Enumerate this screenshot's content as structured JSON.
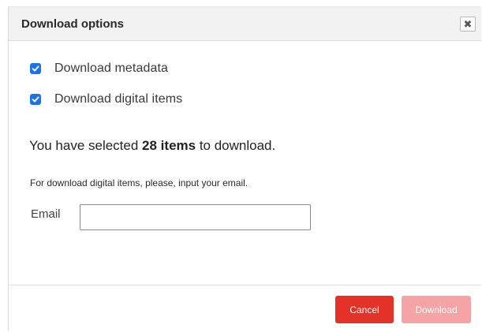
{
  "dialog": {
    "title": "Download options",
    "close_glyph": "✖",
    "close_icon": "close-icon"
  },
  "options": [
    {
      "label": "Download metadata",
      "checked": true
    },
    {
      "label": "Download digital items",
      "checked": true
    }
  ],
  "summary": {
    "prefix": "You have selected ",
    "count": "28 items",
    "suffix": " to download."
  },
  "note": "For download digital items, please, input your email.",
  "email": {
    "label": "Email",
    "value": "",
    "placeholder": ""
  },
  "buttons": {
    "cancel": "Cancel",
    "download": "Download"
  },
  "colors": {
    "checkbox": "#1a73e8",
    "cancel": "#e53228",
    "download_disabled": "#f6a3a6"
  }
}
